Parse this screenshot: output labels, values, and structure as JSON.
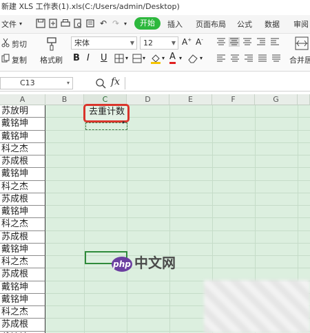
{
  "title": "新建 XLS 工作表(1).xls(C:/Users/admin/Desktop)",
  "menu": {
    "file": "文件",
    "start": "开始",
    "insert": "插入",
    "page_layout": "页面布局",
    "formula": "公式",
    "data": "数据",
    "review": "审阅"
  },
  "ribbon": {
    "cut": "剪切",
    "copy": "复制",
    "format_painter": "格式刷",
    "font_name": "宋体",
    "font_size": "12",
    "merge": "合并居",
    "bold": "B",
    "italic": "I",
    "underline": "U"
  },
  "formula_bar": {
    "cell_ref": "C13",
    "fx": "fx"
  },
  "columns": [
    "A",
    "B",
    "C",
    "D",
    "E",
    "F",
    "G"
  ],
  "column_a": [
    "苏放明",
    "戴铭坤",
    "戴铭坤",
    "科之杰",
    "苏成根",
    "戴铭坤",
    "科之杰",
    "苏成根",
    "戴铭坤",
    "科之杰",
    "苏成根",
    "戴铭坤",
    "科之杰",
    "苏成根",
    "戴铭坤",
    "戴铭坤",
    "科之杰",
    "苏成根",
    "戴铭坤"
  ],
  "c1_text": "去重计数",
  "watermark": {
    "badge": "php",
    "text": "中文网"
  }
}
